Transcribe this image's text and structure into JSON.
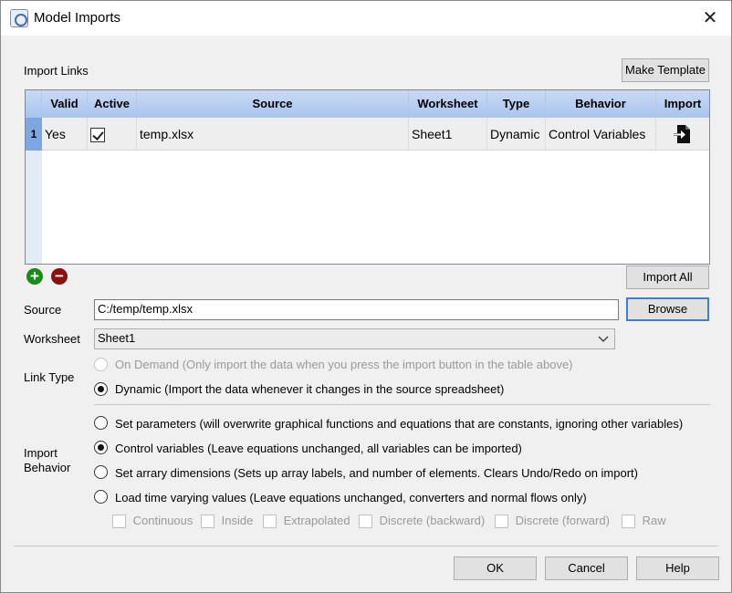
{
  "window": {
    "title": "Model Imports",
    "close_glyph": "✕"
  },
  "import_links": {
    "label": "Import Links",
    "make_template": "Make Template",
    "columns": [
      "Valid",
      "Active",
      "Source",
      "Worksheet",
      "Type",
      "Behavior",
      "Import"
    ],
    "rows": [
      {
        "num": "1",
        "valid": "Yes",
        "active": true,
        "source": "temp.xlsx",
        "worksheet": "Sheet1",
        "type": "Dynamic",
        "behavior": "Control Variables",
        "import_icon": "import-file-icon"
      }
    ],
    "add_icon": "plus-icon",
    "remove_icon": "minus-icon",
    "import_all": "Import All"
  },
  "source": {
    "label": "Source",
    "value": "C:/temp/temp.xlsx",
    "browse": "Browse"
  },
  "worksheet": {
    "label": "Worksheet",
    "value": "Sheet1"
  },
  "link_type": {
    "label": "Link Type",
    "options": [
      {
        "text": "On Demand (Only import the data when you press the import button in the table above)",
        "selected": false,
        "disabled": true
      },
      {
        "text": "Dynamic (Import the data whenever it changes in the source spreadsheet)",
        "selected": true,
        "disabled": false
      }
    ]
  },
  "import_behavior": {
    "label": "Import Behavior",
    "options": [
      {
        "text": "Set parameters (will overwrite graphical functions and equations that are constants, ignoring other variables)",
        "selected": false
      },
      {
        "text": "Control variables (Leave equations unchanged, all variables can be imported)",
        "selected": true
      },
      {
        "text": "Set arrary dimensions (Sets up array labels, and number of elements. Clears Undo/Redo on import)",
        "selected": false
      },
      {
        "text": "Load time varying values (Leave equations unchanged, converters and normal flows only)",
        "selected": false
      }
    ],
    "sub_options": [
      "Continuous",
      "Inside",
      "Extrapolated",
      "Discrete (backward)",
      "Discrete (forward)",
      "Raw"
    ]
  },
  "footer": {
    "ok": "OK",
    "cancel": "Cancel",
    "help": "Help"
  },
  "colors": {
    "header_bg": "#a9c4ee",
    "row_num_bg": "#7ea6e0",
    "add": "#1a8a1a",
    "remove": "#8b1010"
  }
}
